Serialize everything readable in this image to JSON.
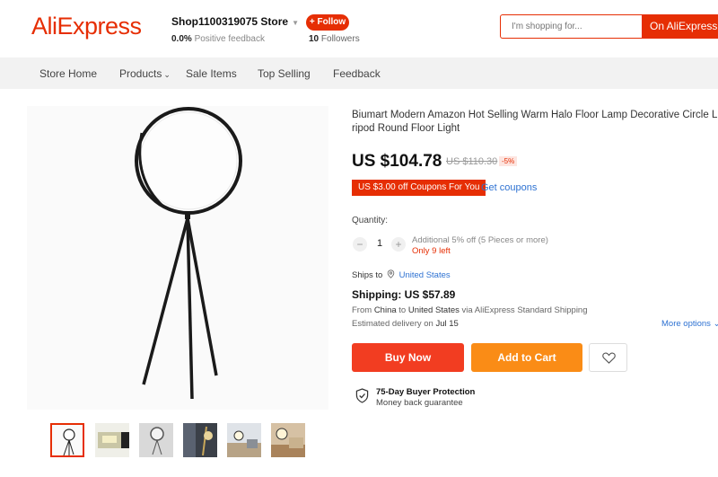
{
  "header": {
    "logo": "AliExpress",
    "store_name": "Shop1100319075 Store",
    "positive_feedback_value": "0.0%",
    "positive_feedback_label": "Positive feedback",
    "follow_label": "+ Follow",
    "followers_count": "10",
    "followers_label": "Followers",
    "search_placeholder": "I'm shopping for...",
    "search_button": "On AliExpress"
  },
  "nav": {
    "items": [
      "Store Home",
      "Products",
      "Sale Items",
      "Top Selling",
      "Feedback"
    ]
  },
  "product": {
    "title_line1": "Biumart Modern Amazon Hot Selling Warm Halo Floor Lamp Decorative Circle LED T",
    "title_line2": "ripod Round Floor Light",
    "price": "US $104.78",
    "old_price": "US $110.30",
    "discount": "-5%",
    "coupon": "US $3.00 off Coupons For You",
    "get_coupons": "Get coupons",
    "quantity_label": "Quantity:",
    "quantity_value": "1",
    "quantity_minus": "−",
    "quantity_plus": "+",
    "additional_off": "Additional 5% off (5 Pieces or more)",
    "only_left": "Only 9 left",
    "ships_to_label": "Ships to",
    "ships_to_location": "United States",
    "shipping": "Shipping: US $57.89",
    "route_from": "From",
    "route_origin": "China",
    "route_to": "to",
    "route_dest": "United States",
    "route_via": "via AliExpress Standard Shipping",
    "est_label": "Estimated delivery on",
    "est_date": "Jul 15",
    "more_options": "More options",
    "buy_now": "Buy Now",
    "add_to_cart": "Add to Cart",
    "protection_title": "75-Day Buyer Protection",
    "protection_sub": "Money back guarantee"
  },
  "colors": {
    "brand": "#e62e04",
    "link": "#2e72d2",
    "buy_now": "#f23d21",
    "add_to_cart": "#fa8c16"
  }
}
